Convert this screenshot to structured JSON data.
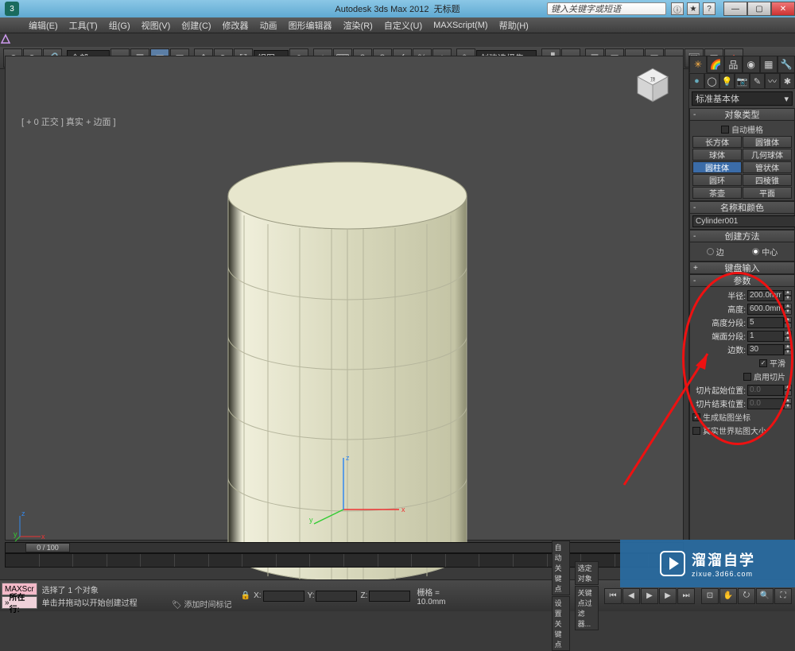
{
  "title": {
    "app": "Autodesk 3ds Max  2012",
    "doc": "无标题",
    "search_placeholder": "键入关键字或短语"
  },
  "menubar": [
    "编辑(E)",
    "工具(T)",
    "组(G)",
    "视图(V)",
    "创建(C)",
    "修改器",
    "动画",
    "图形编辑器",
    "渲染(R)",
    "自定义(U)",
    "MAXScript(M)",
    "帮助(H)"
  ],
  "toolbar_dropdowns": {
    "all": "全部",
    "view": "视图",
    "selset": "创建选择集"
  },
  "viewport_label": "[ + 0 正交 ] 真实 + 边面 ]",
  "cmdpanel": {
    "category": "标准基本体",
    "rollouts": {
      "object_type": {
        "title": "对象类型",
        "auto_grid": "自动栅格",
        "buttons": [
          "长方体",
          "圆锥体",
          "球体",
          "几何球体",
          "圆柱体",
          "管状体",
          "圆环",
          "四棱锥",
          "茶壶",
          "平面"
        ],
        "selected": "圆柱体"
      },
      "name_color": {
        "title": "名称和颜色",
        "name": "Cylinder001"
      },
      "create_method": {
        "title": "创建方法",
        "options": [
          "边",
          "中心"
        ],
        "selected": "中心"
      },
      "keyboard_entry": "键盘输入",
      "params": {
        "title": "参数",
        "radius_label": "半径:",
        "radius": "200.0mm",
        "height_label": "高度:",
        "height": "600.0mm",
        "height_segs_label": "高度分段:",
        "height_segs": "5",
        "cap_segs_label": "端面分段:",
        "cap_segs": "1",
        "sides_label": "边数:",
        "sides": "30",
        "smooth": "平滑",
        "smooth_on": true,
        "slice_on": "启用切片",
        "slice_on_val": false,
        "slice_from_label": "切片起始位置:",
        "slice_from": "0.0",
        "slice_to_label": "切片结束位置:",
        "slice_to": "0.0",
        "gen_map": "生成贴图坐标",
        "gen_map_on": true,
        "real_world": "真实世界贴图大小",
        "real_world_on": false
      }
    }
  },
  "timeline": {
    "knob": "0 / 100"
  },
  "status": {
    "maxscript": "MAXScr",
    "row_label": "所在行:",
    "prompt1": "选择了 1 个对象",
    "prompt2": "单击并拖动以开始创建过程",
    "lock": "🔒",
    "x_label": "X:",
    "y_label": "Y:",
    "z_label": "Z:",
    "grid_label": "栅格 = 10.0mm",
    "autokey": "自动关键点",
    "selkey": "选定对象",
    "setkey": "设置关键点",
    "keyfilter": "关键点过滤器...",
    "addtime": "添加时间标记"
  },
  "watermark": {
    "big": "溜溜自学",
    "small": "zixue.3d66.com"
  }
}
